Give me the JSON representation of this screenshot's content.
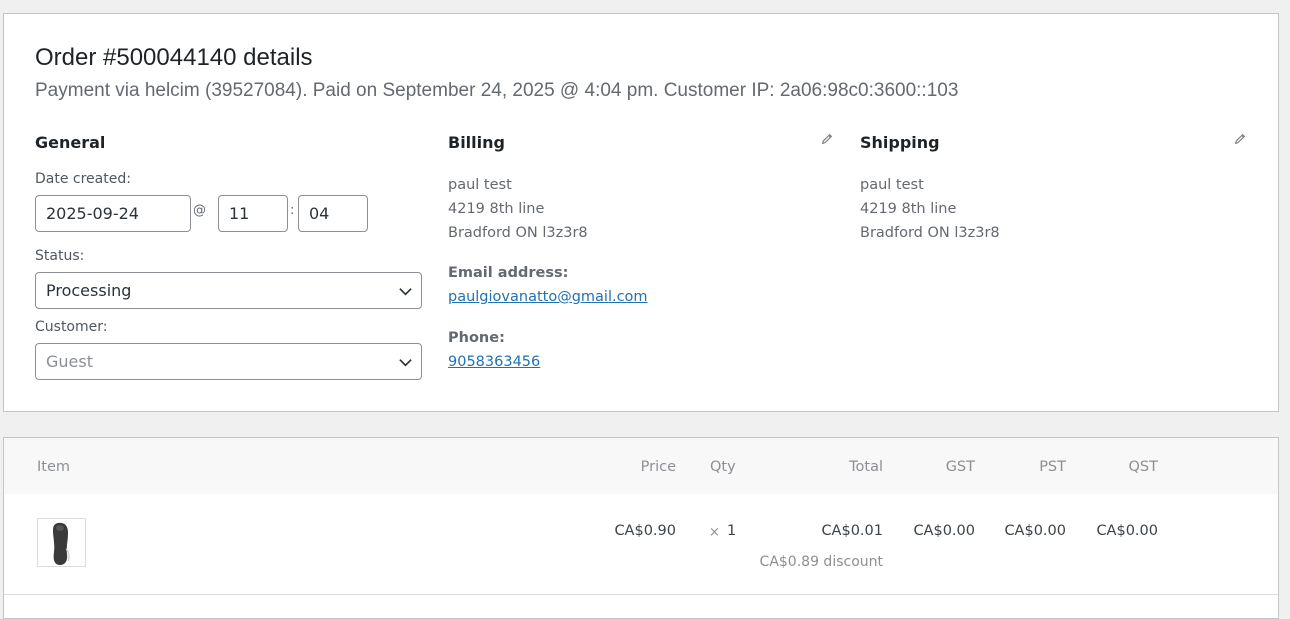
{
  "order": {
    "title": "Order #500044140 details",
    "meta": "Payment via helcim (39527084). Paid on September 24, 2025 @ 4:04 pm. Customer IP: 2a06:98c0:3600::103"
  },
  "general": {
    "heading": "General",
    "date_label": "Date created:",
    "date_value": "2025-09-24",
    "at_symbol": "@",
    "hour_value": "11",
    "colon": ":",
    "minute_value": "04",
    "status_label": "Status:",
    "status_value": "Processing",
    "customer_label": "Customer:",
    "customer_value": "Guest"
  },
  "billing": {
    "heading": "Billing",
    "name": "paul test",
    "address1": "4219 8th line",
    "address2": "Bradford ON l3z3r8",
    "email_label": "Email address:",
    "email": "paulgiovanatto@gmail.com",
    "phone_label": "Phone:",
    "phone": "9058363456"
  },
  "shipping": {
    "heading": "Shipping",
    "name": "paul test",
    "address1": "4219 8th line",
    "address2": "Bradford ON l3z3r8"
  },
  "items_table": {
    "headers": [
      "Item",
      "Price",
      "Qty",
      "Total",
      "GST",
      "PST",
      "QST"
    ],
    "rows": [
      {
        "price": "CA$0.90",
        "qty_sign": "×",
        "qty": "1",
        "total": "CA$0.01",
        "discount": "CA$0.89 discount",
        "gst": "CA$0.00",
        "pst": "CA$0.00",
        "qst": "CA$0.00"
      }
    ]
  },
  "icons": {
    "edit": "pencil-icon",
    "dropdown": "chevron-down-icon",
    "product": "shoe-thumbnail"
  }
}
